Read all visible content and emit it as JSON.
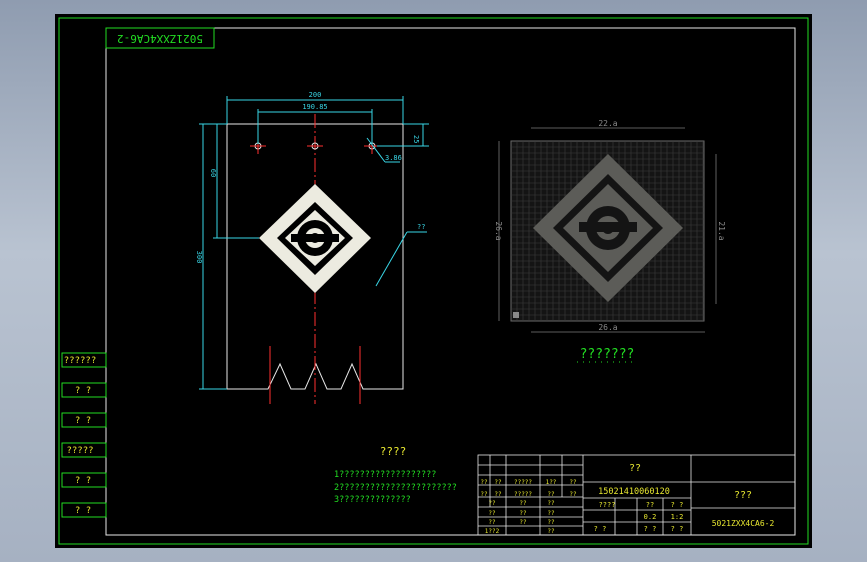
{
  "drawing": {
    "stamp_number": "5021ZXX4CA6-2",
    "dimensions": {
      "overall_width": "200",
      "hole_spacing": "190.85",
      "edge_offset": "25",
      "hole_dia": "3.86",
      "height_a": "60",
      "height_b": "300",
      "leader_note": "??"
    },
    "preview_dims": {
      "top": "22.a",
      "bottom": "26.a",
      "left": "26.a",
      "right": "21.a"
    },
    "preview_caption": "???????",
    "notes": {
      "title": "????",
      "lines": [
        "1???????????????????",
        "2???????????????????????",
        "3??????????????"
      ]
    },
    "left_column": [
      "??????",
      "? ?",
      "? ?",
      "?????",
      "? ?",
      "? ?"
    ],
    "title_block": {
      "title": "??",
      "code": "15021410060120",
      "part_label": "???",
      "drawing_no": "5021ZXX4CA6-2",
      "row_headers": [
        "??",
        "??",
        "?????",
        "??",
        "??"
      ],
      "grid": {
        "r1": [
          "??",
          "??",
          "?????",
          "1??",
          "??"
        ],
        "r2": [
          "??",
          "??",
          "??"
        ],
        "r3": [
          "??",
          "??",
          "??"
        ],
        "r4": [
          "??",
          "??",
          "??"
        ],
        "r5": [
          "1??2",
          "??"
        ]
      },
      "meta": {
        "a": "????",
        "b": "??",
        "c": "? ?",
        "d": "0.2",
        "e": "1:2",
        "f": "? ?",
        "g": "? ?",
        "h": "? ?"
      }
    },
    "colors": {
      "frame": "#22dd22",
      "dimension": "#39d6e6",
      "center_line": "#ff3030",
      "text": "#e8e830"
    }
  }
}
